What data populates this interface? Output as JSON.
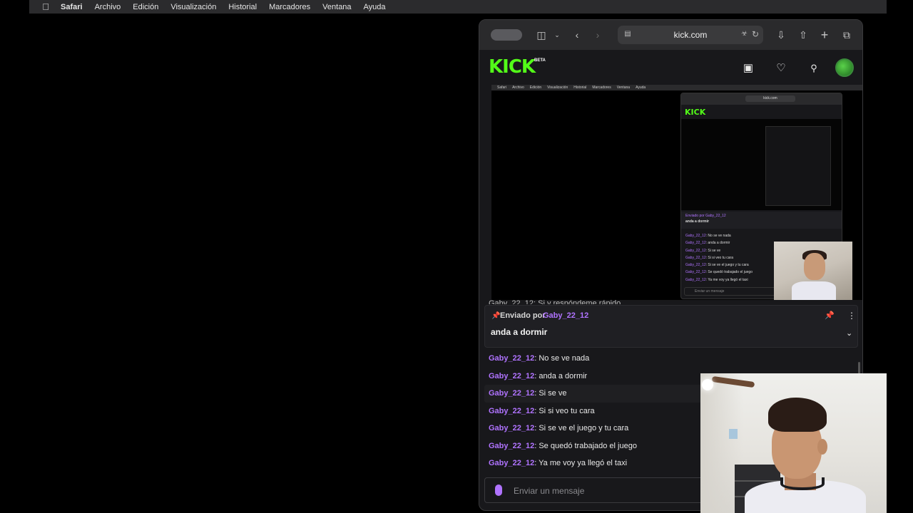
{
  "menubar": {
    "app": "Safari",
    "items": [
      "Archivo",
      "Edición",
      "Visualización",
      "Historial",
      "Marcadores",
      "Ventana",
      "Ayuda"
    ]
  },
  "browser": {
    "url": "kick.com"
  },
  "kick": {
    "logo": "KICK",
    "badge": "BETA"
  },
  "stream": {
    "nested_menubar": [
      "Safari",
      "Archivo",
      "Edición",
      "Visualización",
      "Historial",
      "Marcadores",
      "Ventana",
      "Ayuda"
    ],
    "nested_url": "kick.com",
    "nested_logo": "KICK",
    "nested_pinned_by": "Enviado por Gaby_22_12",
    "nested_pinned_msg": "anda a dormir",
    "nested_chat": [
      {
        "user": "Gaby_22_12",
        "text": "No se ve nada"
      },
      {
        "user": "Gaby_22_12",
        "text": "anda a dormir"
      },
      {
        "user": "Gaby_22_12",
        "text": "Si se ve"
      },
      {
        "user": "Gaby_22_12",
        "text": "Si si veo tu cara"
      },
      {
        "user": "Gaby_22_12",
        "text": "Si se ve el juego y tu cara"
      },
      {
        "user": "Gaby_22_12",
        "text": "Se quedó trabajado el juego"
      },
      {
        "user": "Gaby_22_12",
        "text": "Ya me voy ya llegó el taxi"
      }
    ],
    "nested_input_placeholder": "Enviar un mensaje",
    "cut_message": "Gaby_22_12: Si y respóndeme rápido"
  },
  "pinned": {
    "label": "Enviado por",
    "user": "Gaby_22_12",
    "message": "anda a dormir"
  },
  "chat": [
    {
      "user": "Gaby_22_12",
      "text": "No se ve nada"
    },
    {
      "user": "Gaby_22_12",
      "text": "anda a dormir"
    },
    {
      "user": "Gaby_22_12",
      "text": "Si se ve"
    },
    {
      "user": "Gaby_22_12",
      "text": "Si si veo tu cara"
    },
    {
      "user": "Gaby_22_12",
      "text": "Si se ve el juego y tu cara"
    },
    {
      "user": "Gaby_22_12",
      "text": "Se quedó trabajado el juego"
    },
    {
      "user": "Gaby_22_12",
      "text": "Ya me voy ya llegó el taxi"
    }
  ],
  "input": {
    "placeholder": "Enviar un mensaje"
  },
  "colors": {
    "kick_green": "#53fc18",
    "username_purple": "#b073ff"
  }
}
